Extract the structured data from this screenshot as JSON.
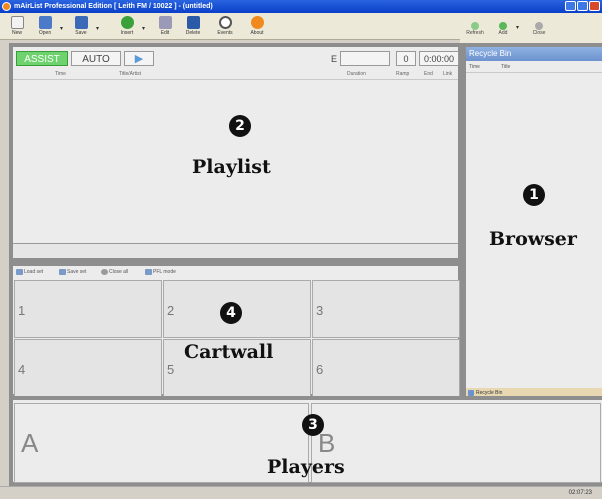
{
  "window": {
    "title": "mAirList Professional Edition [ Leith FM / 10022 ] - (untitled)"
  },
  "toolbar": {
    "buttons": [
      {
        "label": "New"
      },
      {
        "label": "Open"
      },
      {
        "label": "Save"
      },
      {
        "label": "Insert"
      },
      {
        "label": "Edit"
      },
      {
        "label": "Delete"
      },
      {
        "label": "Events"
      },
      {
        "label": "About"
      }
    ]
  },
  "playlist": {
    "assist_label": "ASSIST",
    "auto_label": "AUTO",
    "next_label": "▶",
    "e_label": "E",
    "count": "0",
    "time": "0:00:00",
    "columns": [
      "Time",
      "Title/Artist",
      "Duration",
      "Ramp",
      "End",
      "Link"
    ]
  },
  "browser": {
    "toolbar": [
      {
        "label": "Refresh"
      },
      {
        "label": "Add"
      },
      {
        "label": "Close"
      }
    ],
    "header": "Recycle Bin",
    "columns": [
      "Time",
      "Title"
    ],
    "footer": "Recycle Bin"
  },
  "cartwall": {
    "toolbar": [
      {
        "label": "Load set"
      },
      {
        "label": "Save set"
      },
      {
        "label": "Close all"
      },
      {
        "label": "PFL mode"
      }
    ],
    "carts": [
      "1",
      "2",
      "3",
      "4",
      "5",
      "6"
    ]
  },
  "players": {
    "labels": [
      "A",
      "B"
    ]
  },
  "statusbar": {
    "clock": "02:07:23"
  },
  "annotations": [
    {
      "number": "1",
      "label": "Browser"
    },
    {
      "number": "2",
      "label": "Playlist"
    },
    {
      "number": "3",
      "label": "Players"
    },
    {
      "number": "4",
      "label": "Cartwall"
    }
  ],
  "colors": {
    "assist_active": "#6ed36e",
    "panel_border": "#8e8e8e",
    "title_bar": "#2a64e0"
  }
}
